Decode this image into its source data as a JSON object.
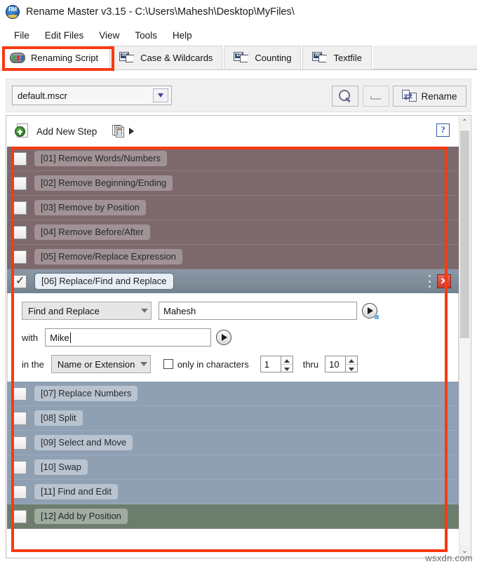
{
  "window": {
    "icon": "app-icon-rm",
    "title": "Rename Master v3.15 - C:\\Users\\Mahesh\\Desktop\\MyFiles\\"
  },
  "menubar": {
    "items": [
      {
        "label": "File"
      },
      {
        "label": "Edit Files"
      },
      {
        "label": "View"
      },
      {
        "label": "Tools"
      },
      {
        "label": "Help"
      }
    ]
  },
  "tabs": [
    {
      "label": "Renaming Script",
      "icon": "script-icon",
      "active": true
    },
    {
      "label": "Case & Wildcards",
      "icon": "ab-document-icon",
      "active": false
    },
    {
      "label": "Counting",
      "icon": "123-document-icon",
      "active": false
    },
    {
      "label": "Textfile",
      "icon": "ab-document-icon",
      "active": false
    }
  ],
  "toolbar": {
    "script_file": "default.mscr",
    "preview_icon": "magnifier-icon",
    "undo_icon": "undo-icon",
    "rename_label": "Rename",
    "rename_icon": "rename-pages-icon"
  },
  "list_header": {
    "add_new_step": "Add New Step",
    "add_icon": "add-document-icon",
    "stack_icon": "script-stack-icon",
    "play_icon": "play-triangle-icon",
    "help_label": "?"
  },
  "steps": [
    {
      "id": "01",
      "label": "[01] Remove Words/Numbers",
      "checked": false,
      "color": "red"
    },
    {
      "id": "02",
      "label": "[02] Remove Beginning/Ending",
      "checked": false,
      "color": "red"
    },
    {
      "id": "03",
      "label": "[03] Remove by Position",
      "checked": false,
      "color": "red"
    },
    {
      "id": "04",
      "label": "[04] Remove Before/After",
      "checked": false,
      "color": "red"
    },
    {
      "id": "05",
      "label": "[05] Remove/Replace Expression",
      "checked": false,
      "color": "red"
    },
    {
      "id": "07",
      "label": "[07] Replace Numbers",
      "checked": false,
      "color": "blue"
    },
    {
      "id": "08",
      "label": "[08] Split",
      "checked": false,
      "color": "blue"
    },
    {
      "id": "09",
      "label": "[09] Select and Move",
      "checked": false,
      "color": "blue"
    },
    {
      "id": "10",
      "label": "[10] Swap",
      "checked": false,
      "color": "blue"
    },
    {
      "id": "11",
      "label": "[11] Find and Edit",
      "checked": false,
      "color": "blue"
    },
    {
      "id": "12",
      "label": "[12] Add by Position",
      "checked": false,
      "color": "green"
    }
  ],
  "expanded_step": {
    "id": "06",
    "title": "[06] Replace/Find and Replace",
    "checked": true,
    "menu_icon": "more-vertical-icon",
    "close_icon": "close-x-icon",
    "mode": "Find and Replace",
    "find_value": "Mahesh",
    "with_label": "with",
    "with_value": "Mike",
    "in_the_label": "in the",
    "scope": "Name or Extension",
    "only_in_characters_label": "only in characters",
    "only_in_characters_checked": false,
    "char_from": "1",
    "thru_label": "thru",
    "char_to": "10",
    "insert_icon": "insert-play-icon"
  },
  "scrollbar": {
    "up_arrow": "⌃",
    "down_arrow": "⌄"
  },
  "annotations": {
    "tab_highlight": "#f93a10",
    "list_highlight": "#f93a10"
  },
  "watermark": "wsxdn.com",
  "colors": {
    "row_red": "#7d696c",
    "row_blue": "#8fa0b3",
    "row_green": "#6d7d6d",
    "accent_red": "#f93a10"
  }
}
